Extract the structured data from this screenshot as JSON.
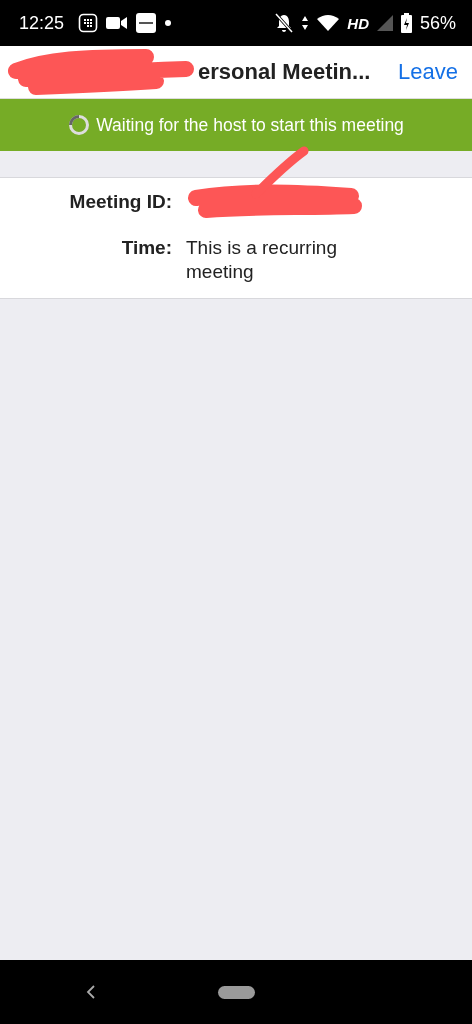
{
  "status_bar": {
    "time": "12:25",
    "network": "HD",
    "battery": "56%"
  },
  "header": {
    "title": "ersonal Meetin...",
    "leave": "Leave"
  },
  "banner": {
    "text": "Waiting for the host to start this meeting"
  },
  "details": [
    {
      "label": "Meeting ID:"
    },
    {
      "label": "Time:",
      "value": "This is a recurring meeting"
    }
  ]
}
